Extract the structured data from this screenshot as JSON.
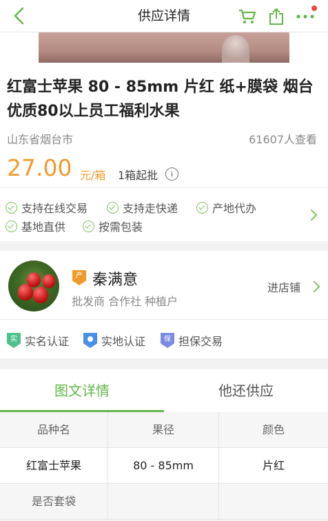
{
  "header": {
    "title": "供应详情",
    "back_icon": "chevron-left-icon",
    "cart_icon": "cart-icon",
    "share_icon": "share-icon",
    "more_icon": "more-icon",
    "accent_color": "#63b54a"
  },
  "product": {
    "title": "红富士苹果 80 - 85mm 片红 纸+膜袋 烟台优质80以上员工福利水果",
    "location": "山东省烟台市",
    "views": "61607人查看",
    "price": "27.00",
    "unit": "元/箱",
    "min_order": "1箱起批",
    "info_icon": "i",
    "price_color": "#f19a2c",
    "features": [
      "支持在线交易",
      "支持走快递",
      "产地代办",
      "基地直供",
      "按需包装"
    ]
  },
  "seller": {
    "badge": "产",
    "name": "秦满意",
    "tags": "批发商 合作社 种植户",
    "shop_link": "进店铺"
  },
  "certifications": [
    {
      "icon_text": "实",
      "label": "实名认证",
      "color": "#4fc08d"
    },
    {
      "icon_text": "",
      "label": "实地认证",
      "color": "#4a90e2"
    },
    {
      "icon_text": "保",
      "label": "担保交易",
      "color": "#7b8be0"
    }
  ],
  "tabs": {
    "active": "图文详情",
    "other": "他还供应"
  },
  "spec_table": {
    "headers": [
      "品种名",
      "果径",
      "颜色"
    ],
    "row1": [
      "红富士苹果",
      "80 - 85mm",
      "片红"
    ],
    "row2_header": "是否套袋"
  }
}
